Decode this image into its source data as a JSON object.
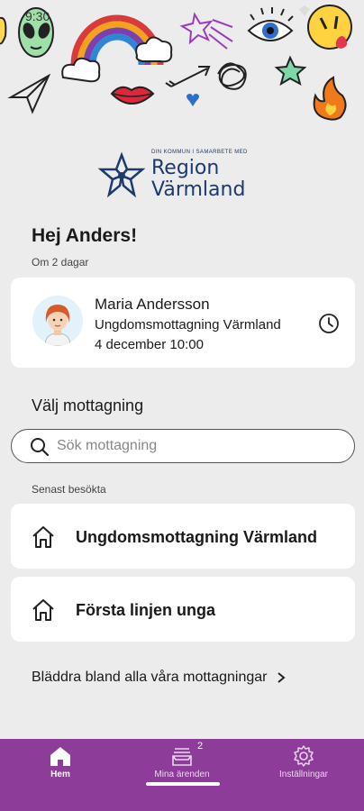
{
  "status_bar": {
    "time": "9:30"
  },
  "logo": {
    "tagline": "DIN KOMMUN I SAMARBETE MED",
    "line1": "Region",
    "line2": "Värmland"
  },
  "greeting": {
    "title": "Hej Anders!",
    "subtitle": "Om 2 dagar"
  },
  "appointment": {
    "name": "Maria Andersson",
    "clinic": "Ungdomsmottagning Värmland",
    "datetime": "4 december 10:00"
  },
  "choose_clinic": {
    "title": "Välj mottagning"
  },
  "search": {
    "placeholder": "Sök mottagning",
    "value": ""
  },
  "recent": {
    "label": "Senast besökta",
    "items": [
      {
        "label": "Ungdomsmottagning Värmland"
      },
      {
        "label": "Första linjen unga"
      }
    ]
  },
  "browse": {
    "label": "Bläddra bland alla våra mottagningar"
  },
  "nav": {
    "items": [
      {
        "label": "Hem"
      },
      {
        "label": "Mina ärenden",
        "badge": "2"
      },
      {
        "label": "Inställningar"
      }
    ]
  },
  "colors": {
    "nav_bg": "#8e3c9a",
    "brand_blue": "#1d3a6e",
    "background": "#ececec"
  }
}
